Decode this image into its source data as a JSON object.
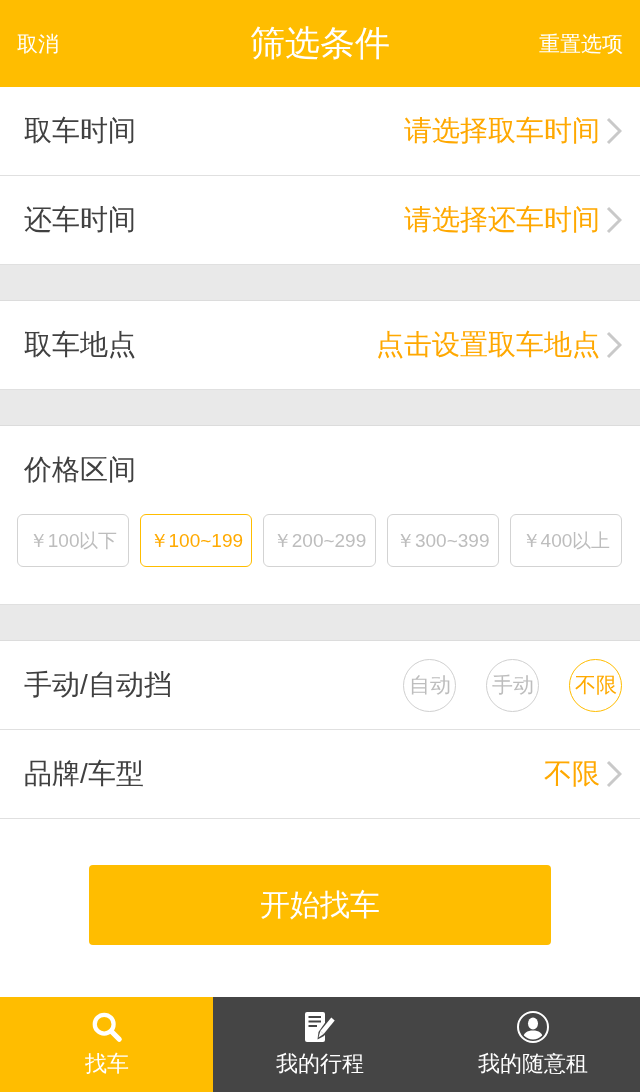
{
  "header": {
    "cancel": "取消",
    "title": "筛选条件",
    "reset": "重置选项"
  },
  "groups": [
    {
      "items": [
        {
          "kind": "link",
          "label": "取车时间",
          "value": "请选择取车时间"
        },
        {
          "kind": "link",
          "label": "还车时间",
          "value": "请选择还车时间"
        }
      ]
    },
    {
      "items": [
        {
          "kind": "link",
          "label": "取车地点",
          "value": "点击设置取车地点"
        }
      ]
    },
    {
      "items": [
        {
          "kind": "chips",
          "label": "价格区间",
          "options": [
            {
              "label": "￥100以下",
              "selected": false
            },
            {
              "label": "￥100~199",
              "selected": true
            },
            {
              "label": "￥200~299",
              "selected": false
            },
            {
              "label": "￥300~399",
              "selected": false
            },
            {
              "label": "￥400以上",
              "selected": false
            }
          ]
        }
      ]
    },
    {
      "items": [
        {
          "kind": "circles",
          "label": "手动/自动挡",
          "options": [
            {
              "label": "自动",
              "selected": false
            },
            {
              "label": "手动",
              "selected": false
            },
            {
              "label": "不限",
              "selected": true
            }
          ]
        },
        {
          "kind": "link",
          "label": "品牌/车型",
          "value": "不限"
        }
      ]
    }
  ],
  "search_button": "开始找车",
  "tabs": [
    {
      "label": "找车",
      "selected": true
    },
    {
      "label": "我的行程",
      "selected": false
    },
    {
      "label": "我的随意租",
      "selected": false
    }
  ]
}
